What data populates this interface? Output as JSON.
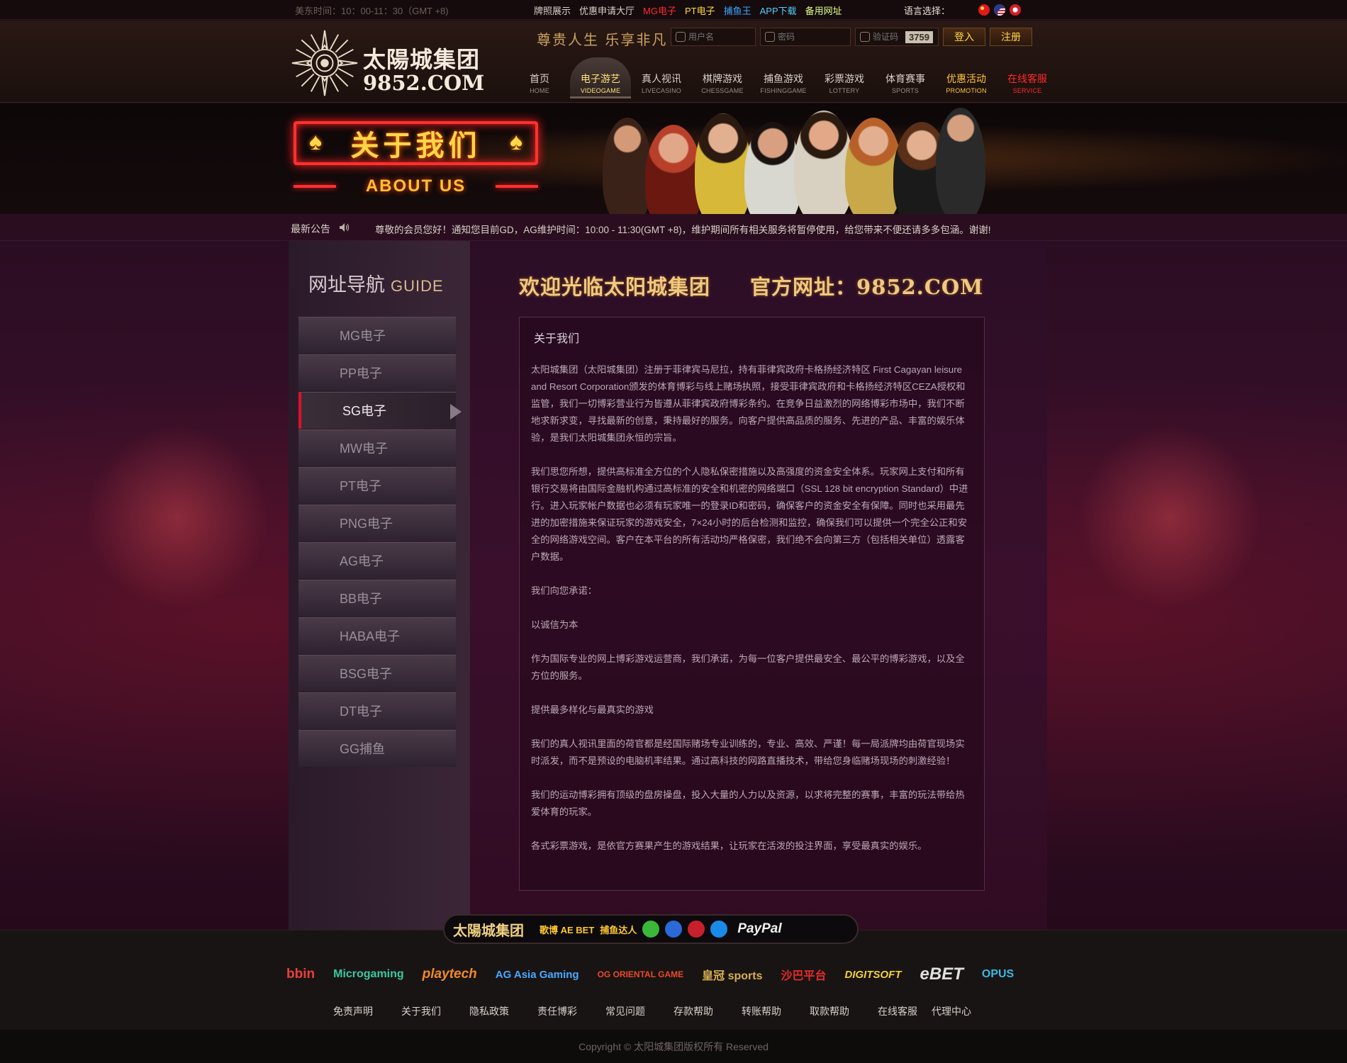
{
  "topbar": {
    "time": "美东时间：10：00-11：30（GMT +8)",
    "links": [
      "牌照展示",
      "优惠申请大厅",
      "MG电子",
      "PT电子",
      "捕鱼王",
      "APP下载",
      "备用网址"
    ],
    "lang_label": "语言选择："
  },
  "header": {
    "logo_cn": "太陽城集团",
    "logo_domain": "9852.COM",
    "slogan": "尊贵人生 乐享非凡",
    "username_placeholder": "用户名",
    "password_placeholder": "密码",
    "captcha_placeholder": "验证码",
    "captcha_code": "3759",
    "login_label": "登入",
    "register_label": "注册",
    "nav": [
      {
        "zh": "首页",
        "en": "HOME"
      },
      {
        "zh": "电子游艺",
        "en": "VIDEOGAME"
      },
      {
        "zh": "真人视讯",
        "en": "LIVECASINO"
      },
      {
        "zh": "棋牌游戏",
        "en": "CHESSGAME"
      },
      {
        "zh": "捕鱼游戏",
        "en": "FISHINGGAME"
      },
      {
        "zh": "彩票游戏",
        "en": "LOTTERY"
      },
      {
        "zh": "体育赛事",
        "en": "SPORTS"
      },
      {
        "zh": "优惠活动",
        "en": "PROMOTION"
      },
      {
        "zh": "在线客服",
        "en": "SERVICE"
      }
    ]
  },
  "banner": {
    "title": "关于我们",
    "subtitle": "ABOUT US"
  },
  "notice": {
    "label": "最新公告",
    "message": "尊敬的会员您好！通知您目前GD，AG维护时间：10:00 - 11:30(GMT +8)，维护期间所有相关服务将暂停使用，给您带来不便还请多多包涵。谢谢!"
  },
  "sidebar": {
    "title": "网址导航",
    "title_en": "GUIDE",
    "items": [
      "MG电子",
      "PP电子",
      "SG电子",
      "MW电子",
      "PT电子",
      "PNG电子",
      "AG电子",
      "BB电子",
      "HABA电子",
      "BSG电子",
      "DT电子",
      "GG捕鱼"
    ],
    "active_index": 2
  },
  "main": {
    "welcome": "欢迎光临太阳城集团",
    "official": "官方网址：9852.COM",
    "section_title": "关于我们",
    "paragraphs": [
      "太阳城集团（太阳城集团）注册于菲律宾马尼拉，持有菲律宾政府卡格扬经济特区 First Cagayan leisure and Resort Corporation颁发的体育博彩与线上赌场执照，接受菲律宾政府和卡格扬经济特区CEZA授权和监管，我们一切博彩营业行为皆遵从菲律宾政府博彩条约。在竞争日益激烈的网络博彩市场中，我们不断地求新求变，寻找最新的创意，秉持最好的服务。向客户提供高品质的服务、先进的产品、丰富的娱乐体验，是我们太阳城集团永恒的宗旨。",
      "我们思您所想，提供高标准全方位的个人隐私保密措施以及高强度的资金安全体系。玩家网上支付和所有银行交易将由国际金融机构通过高标准的安全和机密的网络端口（SSL 128 bit encryption Standard）中进行。进入玩家帐户数据也必须有玩家唯一的登录ID和密码，确保客户的资金安全有保障。同时也采用最先进的加密措施来保证玩家的游戏安全，7×24小时的后台检测和监控，确保我们可以提供一个完全公正和安全的网络游戏空间。客户在本平台的所有活动均严格保密，我们绝不会向第三方（包括相关单位）透露客户数据。",
      "我们向您承诺：",
      "以诚信为本",
      "作为国际专业的网上博彩游戏运营商，我们承诺，为每一位客户提供最安全、最公平的博彩游戏，以及全方位的服务。",
      "提供最多样化与最真实的游戏",
      "我们的真人视讯里面的荷官都是经国际赌场专业训练的，专业、高效、严谨！每一局派牌均由荷官现场实时派发，而不是预设的电脑机率结果。通过高科技的网路直播技术，带给您身临赌场现场的刺激经验！",
      "我们的运动博彩拥有顶级的盘房操盘，投入大量的人力以及资源，以求将完整的赛事，丰富的玩法带给热爱体育的玩家。",
      "各式彩票游戏，是依官方赛果产生的游戏结果，让玩家在活泼的投注界面，享受最真实的娱乐。"
    ]
  },
  "paystrip": {
    "brand": "太陽城集团",
    "logos": [
      "歌博 AE BET",
      "捕鱼达人"
    ],
    "paypal": "PayPal"
  },
  "footer": {
    "partners": [
      "bbin",
      "Microgaming",
      "playtech",
      "AG Asia Gaming",
      "OG ORIENTAL GAME",
      "皇冠 sports",
      "沙巴平台",
      "DIGITSOFT",
      "eBET",
      "OPUS"
    ],
    "links": [
      "免责声明",
      "关于我们",
      "隐私政策",
      "责任博彩",
      "常见问题",
      "存款帮助",
      "转账帮助",
      "取款帮助",
      "在线客服",
      "代理中心"
    ],
    "copyright": "Copyright   ©   太阳城集团版权所有   Reserved"
  },
  "colors": {
    "accent_red": "#ff2a2a",
    "gold": "#ffd84a",
    "bg_purple": "#3a0f2c"
  }
}
